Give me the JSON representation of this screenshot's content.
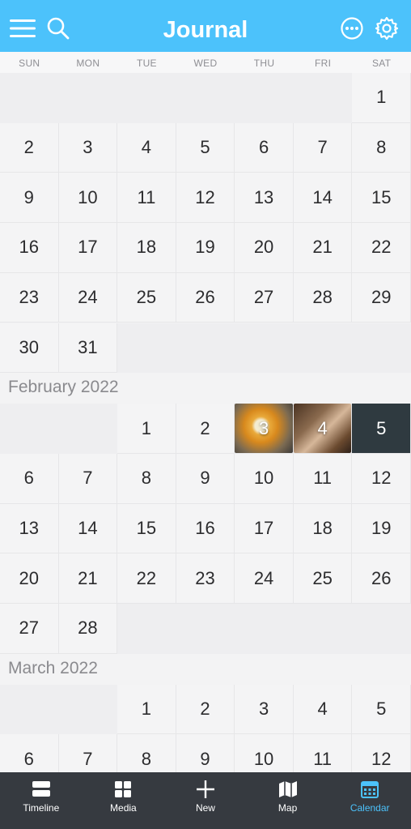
{
  "header": {
    "title": "Journal",
    "icons": [
      "menu-icon",
      "search-icon",
      "more-icon",
      "settings-icon"
    ],
    "color": "#4cc2fb"
  },
  "weekdays": [
    "SUN",
    "MON",
    "TUE",
    "WED",
    "THU",
    "FRI",
    "SAT"
  ],
  "months": [
    {
      "label": "",
      "lead_blank": 6,
      "days": [
        "1",
        "2",
        "3",
        "4",
        "5",
        "6",
        "7",
        "8",
        "9",
        "10",
        "11",
        "12",
        "13",
        "14",
        "15",
        "16",
        "17",
        "18",
        "19",
        "20",
        "21",
        "22",
        "23",
        "24",
        "25",
        "26",
        "27",
        "28",
        "29",
        "30",
        "31"
      ]
    },
    {
      "label": "February 2022",
      "lead_blank": 2,
      "days": [
        "1",
        "2",
        "3",
        "4",
        "5",
        "6",
        "7",
        "8",
        "9",
        "10",
        "11",
        "12",
        "13",
        "14",
        "15",
        "16",
        "17",
        "18",
        "19",
        "20",
        "21",
        "22",
        "23",
        "24",
        "25",
        "26",
        "27",
        "28"
      ],
      "photo_days": [
        "3",
        "4"
      ],
      "selected_day": "5"
    },
    {
      "label": "March 2022",
      "lead_blank": 2,
      "days": [
        "1",
        "2",
        "3",
        "4",
        "5",
        "6",
        "7",
        "8",
        "9",
        "10",
        "11",
        "12"
      ]
    }
  ],
  "tabs": [
    {
      "label": "Timeline",
      "icon": "timeline-icon"
    },
    {
      "label": "Media",
      "icon": "media-grid-icon"
    },
    {
      "label": "New",
      "icon": "plus-icon"
    },
    {
      "label": "Map",
      "icon": "map-icon"
    },
    {
      "label": "Calendar",
      "icon": "calendar-icon",
      "active": true
    }
  ],
  "colors": {
    "accent": "#4cc2fb",
    "tabbar": "#363a40",
    "selected": "#2f3a40"
  }
}
